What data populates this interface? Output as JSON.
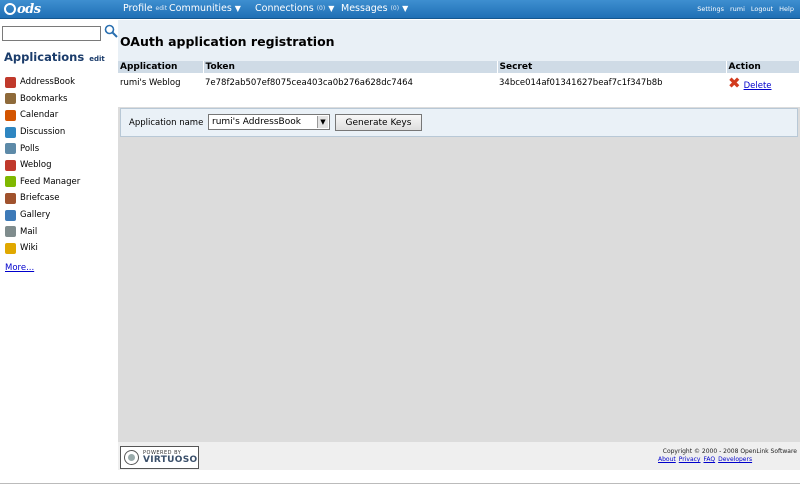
{
  "topbar": {
    "logo": "ods",
    "nav": [
      {
        "label": "Profile",
        "small": "edit",
        "arrow": ""
      },
      {
        "label": "Communities",
        "small": "",
        "arrow": "▼"
      },
      {
        "label": "Connections",
        "small": "(0)",
        "arrow": "▼"
      },
      {
        "label": "Messages",
        "small": "(0)",
        "arrow": "▼"
      }
    ],
    "right_links": [
      "Settings",
      "rumi",
      "Logout",
      "Help"
    ]
  },
  "sidebar": {
    "search": {
      "value": ""
    },
    "apps_title": "Applications",
    "apps_edit": "edit",
    "apps": [
      {
        "label": "AddressBook",
        "color": "#c0392b"
      },
      {
        "label": "Bookmarks",
        "color": "#8e6a3a"
      },
      {
        "label": "Calendar",
        "color": "#d35400"
      },
      {
        "label": "Discussion",
        "color": "#2e86c1"
      },
      {
        "label": "Polls",
        "color": "#5d8aa8"
      },
      {
        "label": "Weblog",
        "color": "#c0392b"
      },
      {
        "label": "Feed Manager",
        "color": "#7fb800"
      },
      {
        "label": "Briefcase",
        "color": "#a0522d"
      },
      {
        "label": "Gallery",
        "color": "#3d7ab8"
      },
      {
        "label": "Mail",
        "color": "#7f8c8d"
      },
      {
        "label": "Wiki",
        "color": "#e0a800"
      }
    ],
    "more": "More..."
  },
  "main": {
    "title": "OAuth application registration",
    "table": {
      "headers": [
        "Application",
        "Token",
        "Secret",
        "Action"
      ],
      "rows": [
        {
          "application": "rumi's Weblog",
          "token": "7e78f2ab507ef8075cea403ca0b276a628dc7464",
          "secret": "34bce014af01341627beaf7c1f347b8b",
          "action": "Delete"
        }
      ]
    },
    "form": {
      "label": "Application name",
      "selected": "rumi's AddressBook",
      "button": "Generate Keys"
    }
  },
  "footer": {
    "badge_top": "POWERED BY",
    "badge_main": "VIRTUOSO",
    "copyright": "Copyright © 2000 - 2008 OpenLink Software",
    "links": [
      "About",
      "Privacy",
      "FAQ",
      "Developers"
    ]
  }
}
